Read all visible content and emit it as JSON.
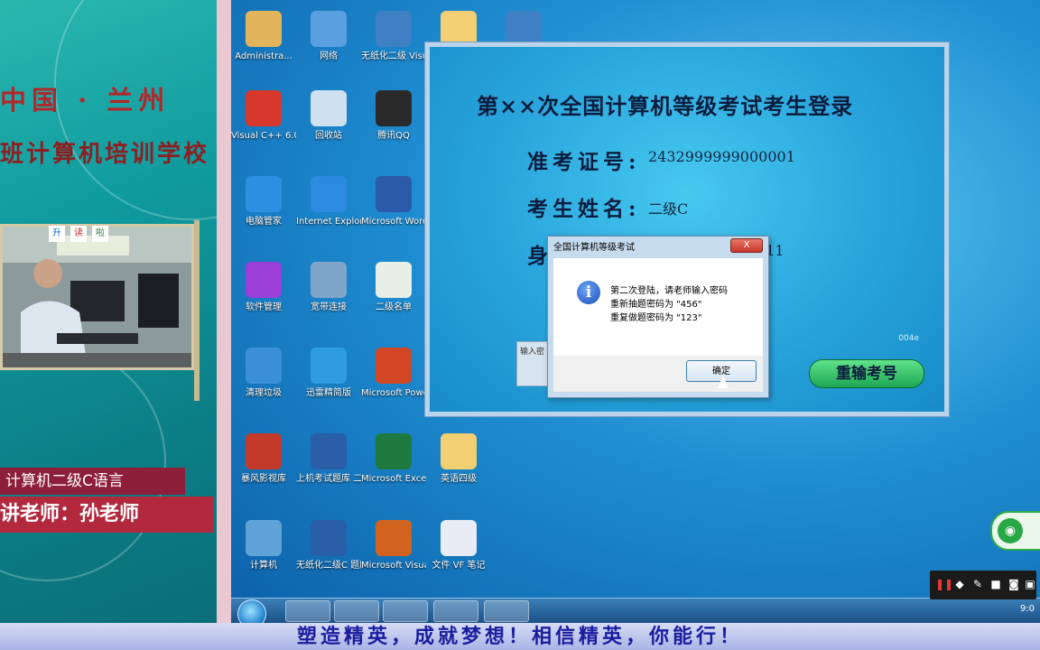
{
  "left_panel": {
    "title_line1": "中国 · 兰州",
    "title_line2": "班计算机培训学校",
    "course": "计算机二级C语言",
    "teacher": "讲老师：孙老师",
    "board_signs": [
      "升",
      "读",
      "啦"
    ]
  },
  "desktop_icons": [
    {
      "label": "Administra...",
      "icon": "user-folder-icon"
    },
    {
      "label": "网络",
      "icon": "network-icon"
    },
    {
      "label": "无纸化二级 Visual Fo...",
      "icon": "app-icon"
    },
    {
      "label": "",
      "icon": "folder-icon"
    },
    {
      "label": "",
      "icon": "app-icon"
    },
    {
      "label": "Visual C++ 6.0",
      "icon": "visual-cpp-icon"
    },
    {
      "label": "回收站",
      "icon": "recycle-bin-icon"
    },
    {
      "label": "腾讯QQ",
      "icon": "qq-icon"
    },
    {
      "label": "电脑管家",
      "icon": "pc-manager-icon"
    },
    {
      "label": "Internet Explorer",
      "icon": "ie-icon"
    },
    {
      "label": "Microsoft Word 2010",
      "icon": "word-icon"
    },
    {
      "label": "软件管理",
      "icon": "software-manager-icon"
    },
    {
      "label": "宽带连接",
      "icon": "broadband-icon"
    },
    {
      "label": "二级名单",
      "icon": "excel-file-icon"
    },
    {
      "label": "清理垃圾",
      "icon": "broom-icon"
    },
    {
      "label": "迅雷精简版",
      "icon": "thunder-icon"
    },
    {
      "label": "Microsoft PowerPoi...",
      "icon": "powerpoint-icon"
    },
    {
      "label": "暴风影视库",
      "icon": "video-library-icon"
    },
    {
      "label": "上机考试题库 二级MS Of...",
      "icon": "exam-bank-icon"
    },
    {
      "label": "Microsoft Excel 2010",
      "icon": "excel-icon"
    },
    {
      "label": "英语四级",
      "icon": "folder-icon"
    },
    {
      "label": "计算机",
      "icon": "computer-icon"
    },
    {
      "label": "无纸化二级C 题库版",
      "icon": "exam-bank-icon"
    },
    {
      "label": "Microsoft Visual Fo...",
      "icon": "foxpro-icon"
    },
    {
      "label": "文件 VF 笔记",
      "icon": "word-file-icon"
    }
  ],
  "login_window": {
    "title": "第××次全国计算机等级考试考生登录",
    "ticket_label": "准考证号:",
    "ticket_value": "2432999999000001",
    "name_label": "考生姓名:",
    "name_value": "二级C",
    "id_label": "身份证号:",
    "id_value": "11111111111111",
    "input_hint": "输入密",
    "retype_button": "重输考号",
    "corner_text": "004e"
  },
  "message_box": {
    "caption": "全国计算机等级考试",
    "close_label": "X",
    "line1": "第二次登陆，请老师输入密码",
    "line2": "重新抽题密码为    \"456\"",
    "line3": "重复做题密码为    \"123\"",
    "ok_label": "确定"
  },
  "taskbar": {
    "clock": "9:0"
  },
  "slogan": "塑造精英，成就梦想！相信精英，你能行！"
}
